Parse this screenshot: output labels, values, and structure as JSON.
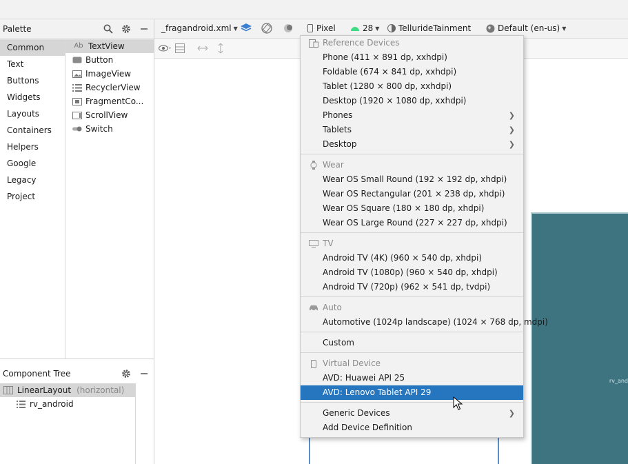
{
  "palette": {
    "title": "Palette",
    "categories": [
      "Common",
      "Text",
      "Buttons",
      "Widgets",
      "Layouts",
      "Containers",
      "Helpers",
      "Google",
      "Legacy",
      "Project"
    ],
    "widgets": [
      {
        "label": "TextView",
        "icon": "textview-icon",
        "icon_text": "Ab"
      },
      {
        "label": "Button",
        "icon": "button-icon"
      },
      {
        "label": "ImageView",
        "icon": "imageview-icon"
      },
      {
        "label": "RecyclerView",
        "icon": "recyclerview-icon"
      },
      {
        "label": "FragmentCo...",
        "icon": "fragment-icon"
      },
      {
        "label": "ScrollView",
        "icon": "scrollview-icon"
      },
      {
        "label": "Switch",
        "icon": "switch-icon"
      }
    ]
  },
  "component_tree": {
    "title": "Component Tree",
    "root": {
      "label": "LinearLayout",
      "hint": "(horizontal)"
    },
    "child": {
      "label": "rv_android"
    }
  },
  "toolbar": {
    "file": "_fragandroid.xml",
    "device": "Pixel",
    "api": "28",
    "theme": "TellurideTainment",
    "locale": "Default (en-us)"
  },
  "canvas": {
    "tablet_label": "rv_and"
  },
  "menu": {
    "sections": {
      "reference": "Reference Devices",
      "wear": "Wear",
      "tv": "TV",
      "auto": "Auto",
      "virtual": "Virtual Device"
    },
    "reference_items": [
      "Phone (411 × 891 dp, xxhdpi)",
      "Foldable (674 × 841 dp, xxhdpi)",
      "Tablet (1280 × 800 dp, xxhdpi)",
      "Desktop (1920 × 1080 dp, xxhdpi)"
    ],
    "reference_groups": [
      "Phones",
      "Tablets",
      "Desktop"
    ],
    "wear_items": [
      "Wear OS Small Round (192 × 192 dp, xhdpi)",
      "Wear OS Rectangular (201 × 238 dp, xhdpi)",
      "Wear OS Square (180 × 180 dp, xhdpi)",
      "Wear OS Large Round (227 × 227 dp, xhdpi)"
    ],
    "tv_items": [
      "Android TV (4K) (960 × 540 dp, xhdpi)",
      "Android TV (1080p) (960 × 540 dp, xhdpi)",
      "Android TV (720p) (962 × 541 dp, tvdpi)"
    ],
    "auto_items": [
      "Automotive (1024p landscape) (1024 × 768 dp, mdpi)"
    ],
    "custom": "Custom",
    "virtual_items": [
      "AVD: Huawei API 25",
      "AVD: Lenovo Tablet API 29"
    ],
    "generic": "Generic Devices",
    "add": "Add Device Definition"
  }
}
